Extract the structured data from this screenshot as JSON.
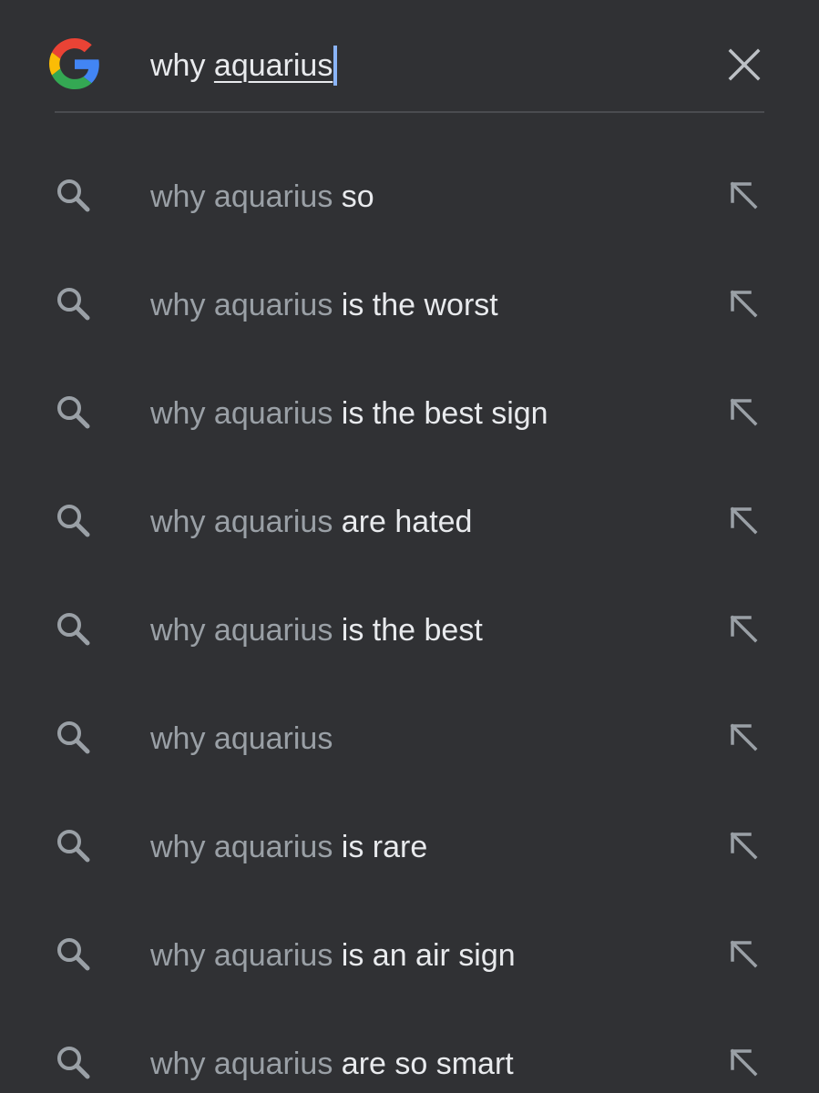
{
  "search": {
    "query_prefix": "why ",
    "query_underlined": "aquarius",
    "logo": "google-g-icon",
    "clear_icon": "close-icon"
  },
  "suggestions": [
    {
      "prefix": "why aquarius",
      "suffix": " so"
    },
    {
      "prefix": "why aquarius",
      "suffix": " is the worst"
    },
    {
      "prefix": "why aquarius",
      "suffix": " is the best sign"
    },
    {
      "prefix": "why aquarius",
      "suffix": " are hated"
    },
    {
      "prefix": "why aquarius",
      "suffix": " is the best"
    },
    {
      "prefix": "why aquarius",
      "suffix": ""
    },
    {
      "prefix": "why aquarius",
      "suffix": " is rare"
    },
    {
      "prefix": "why aquarius",
      "suffix": " is an air sign"
    },
    {
      "prefix": "why aquarius",
      "suffix": " are so smart"
    }
  ],
  "icons": {
    "suggestion_leading": "search-icon",
    "suggestion_trailing": "arrow-up-left-icon"
  },
  "colors": {
    "background": "#303134",
    "text_primary": "#e8eaed",
    "text_secondary": "#9aa0a6",
    "caret": "#8ab4f8"
  }
}
